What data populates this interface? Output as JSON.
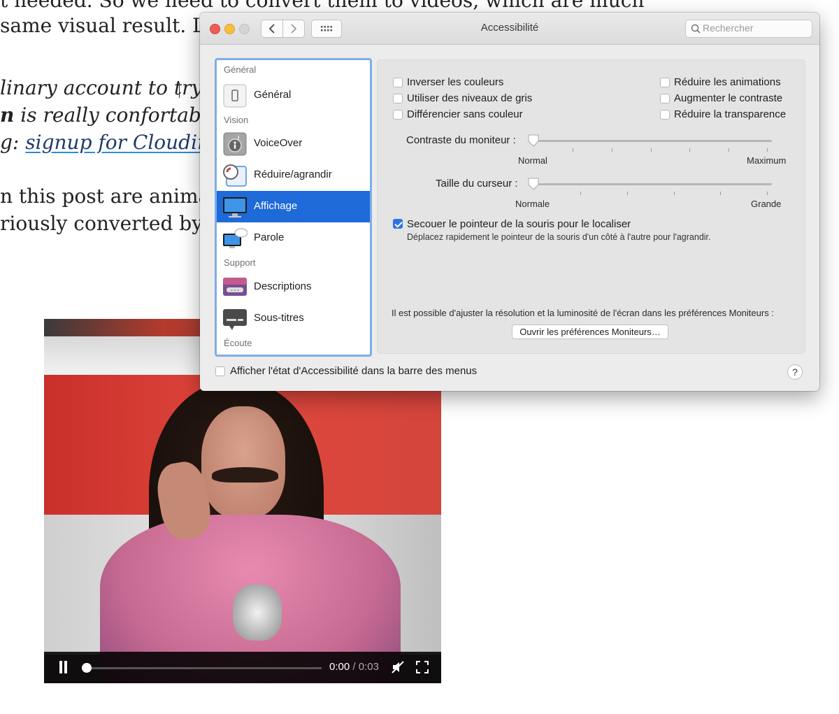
{
  "article": {
    "line1": "t needed. So we need to convert them to videos, which are much",
    "line2": " same visual result. L",
    "line3": "linary account to try all o",
    "line4_bold": "n",
    "line4_rest": " is really confortable fo",
    "line5_prefix": "g: ",
    "line5_link": "signup for Cloudinary.",
    "line6": "n this post are animated G",
    "line7": "riously converted by Clou"
  },
  "video": {
    "time_current": "0:00",
    "time_separator": " / ",
    "time_total": "0:03",
    "progress": 0
  },
  "window": {
    "title": "Accessibilité",
    "search_placeholder": "Rechercher"
  },
  "sidebar": {
    "sections": [
      "Général",
      "Vision",
      "Support",
      "Écoute"
    ],
    "items": [
      {
        "label": "Général",
        "icon": "general-icon"
      },
      {
        "label": "VoiceOver",
        "icon": "voiceover-icon"
      },
      {
        "label": "Réduire/agrandir",
        "icon": "zoom-icon"
      },
      {
        "label": "Affichage",
        "icon": "display-icon"
      },
      {
        "label": "Parole",
        "icon": "speech-icon"
      },
      {
        "label": "Descriptions",
        "icon": "descriptions-icon"
      },
      {
        "label": "Sous-titres",
        "icon": "captions-icon"
      }
    ],
    "selected": "Affichage"
  },
  "display": {
    "checkboxes_left": [
      {
        "label": "Inverser les couleurs",
        "checked": false
      },
      {
        "label": "Utiliser des niveaux de gris",
        "checked": false
      },
      {
        "label": "Différencier sans couleur",
        "checked": false
      }
    ],
    "checkboxes_right": [
      {
        "label": "Réduire les animations",
        "checked": false
      },
      {
        "label": "Augmenter le contraste",
        "checked": false
      },
      {
        "label": "Réduire la transparence",
        "checked": false
      }
    ],
    "contrast": {
      "label": "Contraste du moniteur :",
      "min": "Normal",
      "max": "Maximum",
      "value": 0
    },
    "cursor": {
      "label": "Taille du curseur :",
      "min": "Normale",
      "max": "Grande",
      "value": 0
    },
    "shake": {
      "label": "Secouer le pointeur de la souris pour le localiser",
      "description": "Déplacez rapidement le pointeur de la souris d'un côté à l'autre pour l'agrandir.",
      "checked": true
    },
    "monitor_note": "Il est possible d'ajuster la résolution et la luminosité de l'écran dans les préférences Moniteurs :",
    "open_button": "Ouvrir les préférences Moniteurs…"
  },
  "footer": {
    "menubar_label": "Afficher l'état d'Accessibilité dans la barre des menus",
    "menubar_checked": false,
    "help_label": "?"
  },
  "colors": {
    "accent": "#1e6ad9",
    "close": "#ee5c55",
    "minimize": "#f6be3f"
  }
}
